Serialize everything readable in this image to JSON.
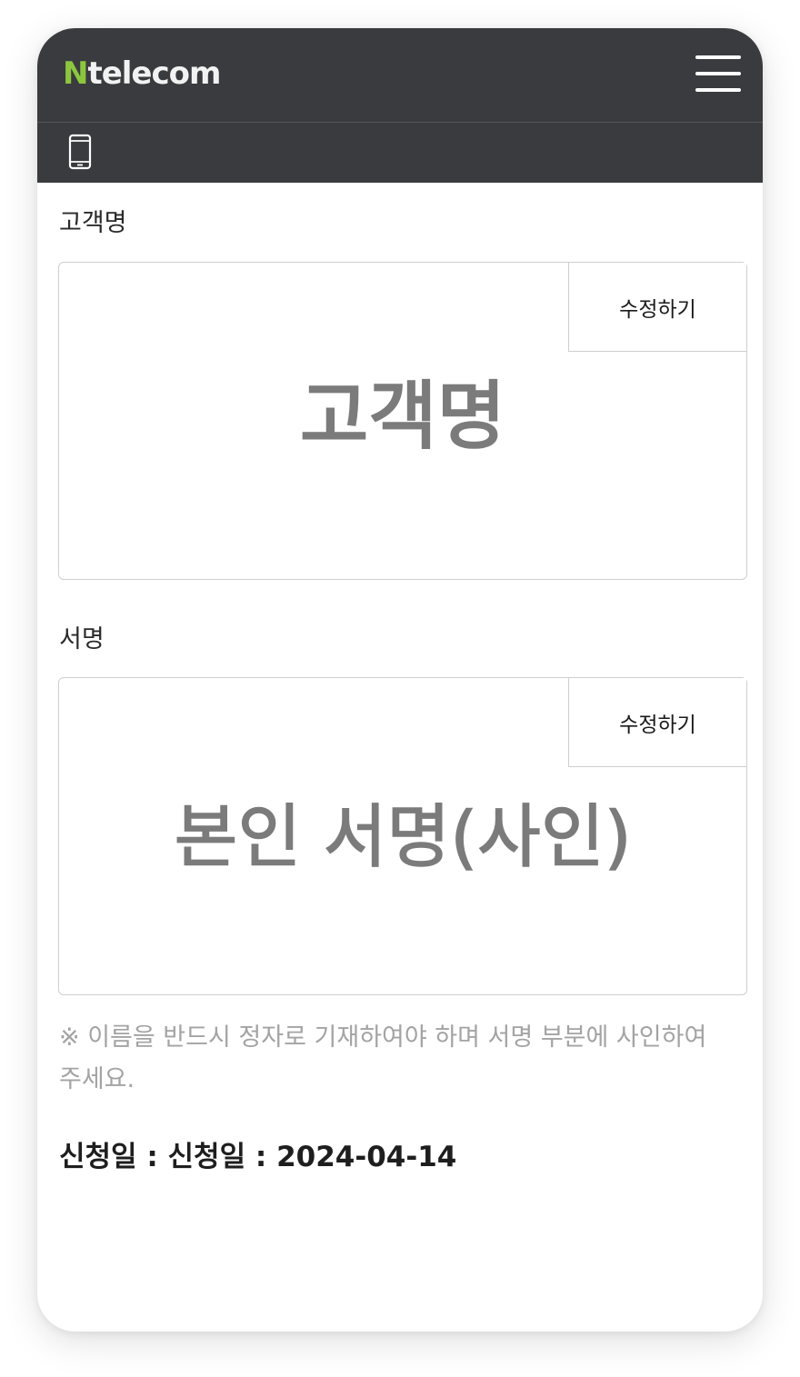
{
  "header": {
    "logo_n": "N",
    "logo_rest": "telecom",
    "brand_accent": "#8cc63f",
    "background": "#3a3b3f",
    "menu_icon": "hamburger-menu-icon"
  },
  "subbar": {
    "icon": "mobile-phone-icon"
  },
  "customer_name_section": {
    "label": "고객명",
    "edit_label": "수정하기",
    "placeholder": "고객명"
  },
  "signature_section": {
    "label": "서명",
    "edit_label": "수정하기",
    "placeholder": "본인 서명(사인)"
  },
  "notice": "※ 이름을 반드시 정자로 기재하여야 하며 서명 부분에 사인하여 주세요.",
  "apply_date": "신청일 : 신청일 : 2024-04-14"
}
